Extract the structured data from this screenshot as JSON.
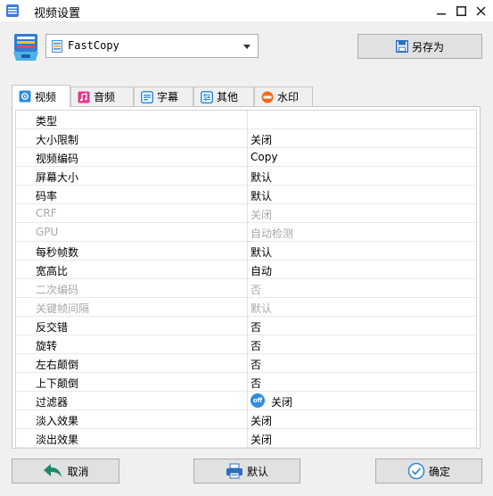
{
  "window": {
    "title": "视频设置"
  },
  "preset": {
    "value": "FastCopy"
  },
  "toolbar": {
    "save_as_label": "另存为"
  },
  "tabs": [
    {
      "label": "视频",
      "icon": "video-icon",
      "active": true
    },
    {
      "label": "音频",
      "icon": "music-icon",
      "active": false
    },
    {
      "label": "字幕",
      "icon": "subtitle-icon",
      "active": false
    },
    {
      "label": "其他",
      "icon": "settings-icon",
      "active": false
    },
    {
      "label": "水印",
      "icon": "new-badge-icon",
      "active": false
    }
  ],
  "settings": [
    {
      "key": "类型",
      "value": "",
      "disabled": false
    },
    {
      "key": "大小限制",
      "value": "关闭",
      "disabled": false
    },
    {
      "key": "视频编码",
      "value": "Copy",
      "disabled": false
    },
    {
      "key": "屏幕大小",
      "value": "默认",
      "disabled": false
    },
    {
      "key": "码率",
      "value": "默认",
      "disabled": false
    },
    {
      "key": "CRF",
      "value": "关闭",
      "disabled": true
    },
    {
      "key": "GPU",
      "value": "自动检测",
      "disabled": true
    },
    {
      "key": "每秒帧数",
      "value": "默认",
      "disabled": false
    },
    {
      "key": "宽高比",
      "value": "自动",
      "disabled": false
    },
    {
      "key": "二次编码",
      "value": "否",
      "disabled": true
    },
    {
      "key": "关键帧间隔",
      "value": "默认",
      "disabled": true
    },
    {
      "key": "反交错",
      "value": "否",
      "disabled": false
    },
    {
      "key": "旋转",
      "value": "否",
      "disabled": false
    },
    {
      "key": "左右颠倒",
      "value": "否",
      "disabled": false
    },
    {
      "key": "上下颠倒",
      "value": "否",
      "disabled": false
    },
    {
      "key": "过滤器",
      "value": "关闭",
      "disabled": false,
      "badge": "off"
    },
    {
      "key": "淡入效果",
      "value": "关闭",
      "disabled": false
    },
    {
      "key": "淡出效果",
      "value": "关闭",
      "disabled": false
    }
  ],
  "footer": {
    "cancel_label": "取消",
    "default_label": "默认",
    "ok_label": "确定"
  },
  "colors": {
    "accent": "#2f8ddc",
    "back_arrow": "#1a8a6a",
    "disabled_text": "#a8a8a8"
  }
}
